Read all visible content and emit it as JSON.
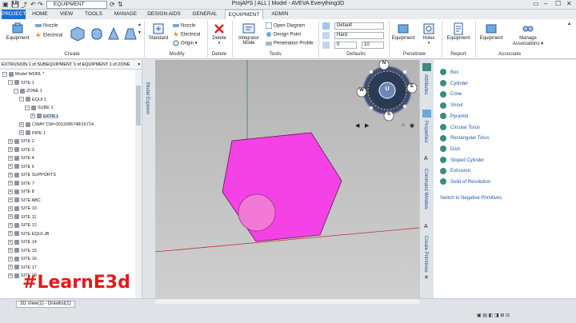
{
  "titlebar": {
    "combo_value": "EQUIPMENT",
    "title": "ProjAPS | ALL | Model - AVEVA Everything3D"
  },
  "tabs": [
    "PROJECT",
    "HOME",
    "VIEW",
    "TOOLS",
    "MANAGE",
    "DESIGN AIDS",
    "GENERAL",
    "EQUIPMENT",
    "ADMIN"
  ],
  "ribbon": {
    "create": {
      "label": "Create",
      "equipment": "Equipment",
      "nozzle": "Nozzle",
      "electrical": "Electrical"
    },
    "modify": {
      "label": "Modify",
      "standard": "Standard",
      "nozzle": "Nozzle",
      "electrical": "Electrical",
      "origin": "Origin"
    },
    "delete": {
      "label": "Delete",
      "delete_btn": "Delete"
    },
    "tools": {
      "label": "Tools",
      "integrator": "Integrator Mode",
      "open_diagram": "Open Diagram",
      "design_point": "Design Point",
      "penetration_profile": "Penetration Profile"
    },
    "defaults": {
      "label": "Defaults",
      "default_value": "Default",
      "hard_value": "Hard",
      "num_from": "0",
      "num_to": "10"
    },
    "penetrate": {
      "label": "Penetrate",
      "equipment": "Equipment",
      "holes": "Holes"
    },
    "report": {
      "label": "Report",
      "equipment": "Equipment"
    },
    "associate": {
      "label": "Associate",
      "manage_associations": "Manage Associations"
    }
  },
  "explorer": {
    "header": "EXTRUSION 1 of SUBEQUIPMENT 1 of EQUIPMENT 1 of ZONE",
    "tree": [
      {
        "label": "Model WORL *",
        "indent": 0
      },
      {
        "label": "SITE 1",
        "indent": 1
      },
      {
        "label": "ZONE 1",
        "indent": 2
      },
      {
        "label": "EQUI 1",
        "indent": 3
      },
      {
        "label": "SUBE 1",
        "indent": 4
      },
      {
        "label": "EXTR 1",
        "indent": 5
      },
      {
        "label": "CWAY CW=2013286748/16714",
        "indent": 3
      },
      {
        "label": "PIPE 1",
        "indent": 3
      },
      {
        "label": "SITE 2",
        "indent": 1
      },
      {
        "label": "SITE 3",
        "indent": 1
      },
      {
        "label": "SITE 4",
        "indent": 1
      },
      {
        "label": "SITE 6",
        "indent": 1
      },
      {
        "label": "SITE SUPPORTS",
        "indent": 1
      },
      {
        "label": "SITE 7",
        "indent": 1
      },
      {
        "label": "SITE 8",
        "indent": 1
      },
      {
        "label": "SITE ABC",
        "indent": 1
      },
      {
        "label": "SITE 10",
        "indent": 1
      },
      {
        "label": "SITE 11",
        "indent": 1
      },
      {
        "label": "SITE 12",
        "indent": 1
      },
      {
        "label": "SITE EQUI-JB",
        "indent": 1
      },
      {
        "label": "SITE 14",
        "indent": 1
      },
      {
        "label": "SITE 15",
        "indent": 1
      },
      {
        "label": "SITE 16",
        "indent": 1
      },
      {
        "label": "SITE 17",
        "indent": 1
      },
      {
        "label": "SITE 18",
        "indent": 1
      }
    ]
  },
  "left_strip": {
    "model_explorer": "Model Explorer"
  },
  "right_strip": {
    "attributes": "Attributes",
    "properties": "Properties",
    "command_window": "Command Window",
    "create_primitives": "Create Primitives"
  },
  "palette": {
    "items": [
      "Box",
      "Cylinder",
      "Cone",
      "Snout",
      "Pyramid",
      "Circular Torus",
      "Rectangular Torus",
      "Dish",
      "Sloped Cylinder",
      "Extrusion",
      "Solid of Revolution"
    ],
    "switch": "Switch to Negative Primitives"
  },
  "viewcube": {
    "n": "N",
    "s": "S",
    "e": "E",
    "w": "W",
    "u": "U"
  },
  "bottom": {
    "view_tab": "3D View(1) - Drawlist(1)",
    "watermark": "#LearnE3d"
  },
  "colors": {
    "hexagon": "#f542e6",
    "circle": "#f27ad6",
    "accent": "#1f6fd1"
  }
}
